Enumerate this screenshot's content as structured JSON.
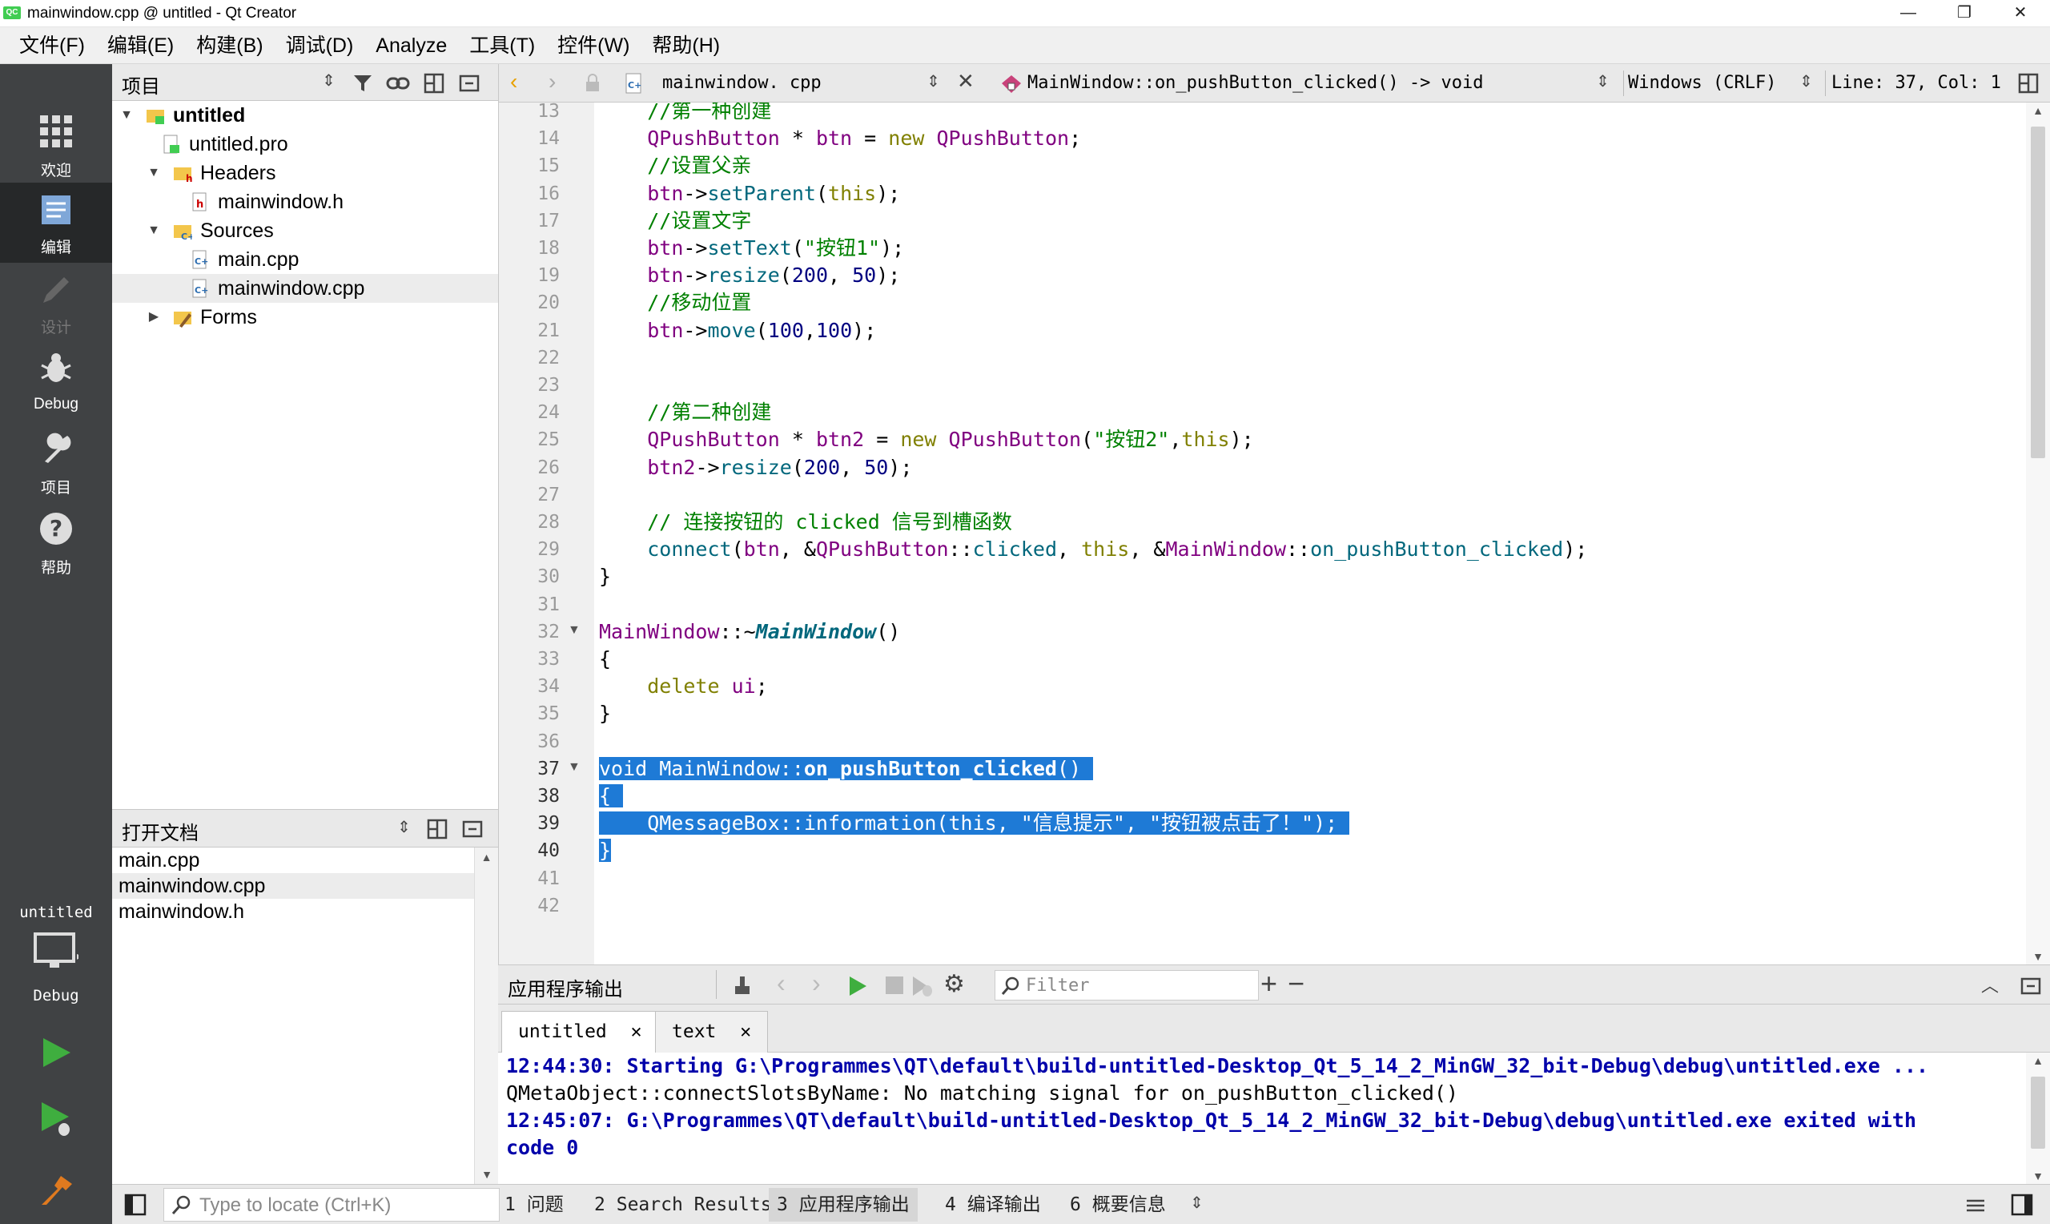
{
  "window": {
    "title": "mainwindow.cpp @ untitled - Qt Creator",
    "app_icon": "QC",
    "controls": {
      "minimize": "—",
      "maximize": "❐",
      "close": "✕"
    }
  },
  "menubar": [
    "文件(F)",
    "编辑(E)",
    "构建(B)",
    "调试(D)",
    "Analyze",
    "工具(T)",
    "控件(W)",
    "帮助(H)"
  ],
  "modes": [
    {
      "id": "welcome",
      "label": "欢迎",
      "icon": "grid-icon"
    },
    {
      "id": "edit",
      "label": "编辑",
      "icon": "edit-icon",
      "active": true
    },
    {
      "id": "design",
      "label": "设计",
      "icon": "pencil-icon",
      "disabled": true
    },
    {
      "id": "debug",
      "label": "Debug",
      "icon": "bug-icon"
    },
    {
      "id": "projects",
      "label": "项目",
      "icon": "wrench-icon"
    },
    {
      "id": "help",
      "label": "帮助",
      "icon": "help-icon"
    }
  ],
  "kit": {
    "project": "untitled",
    "config": "Debug"
  },
  "project_panel": {
    "title": "项目",
    "tree": [
      {
        "label": "untitled",
        "level": 0,
        "expanded": true,
        "bold": true,
        "icon": "project-folder-icon"
      },
      {
        "label": "untitled.pro",
        "level": 1,
        "icon": "pro-file-icon"
      },
      {
        "label": "Headers",
        "level": 1,
        "expanded": true,
        "icon": "headers-folder-icon"
      },
      {
        "label": "mainwindow.h",
        "level": 2,
        "icon": "header-file-icon"
      },
      {
        "label": "Sources",
        "level": 1,
        "expanded": true,
        "icon": "sources-folder-icon"
      },
      {
        "label": "main.cpp",
        "level": 2,
        "icon": "cpp-file-icon"
      },
      {
        "label": "mainwindow.cpp",
        "level": 2,
        "icon": "cpp-file-icon",
        "selected": true
      },
      {
        "label": "Forms",
        "level": 1,
        "expanded": false,
        "icon": "forms-folder-icon"
      }
    ]
  },
  "open_docs": {
    "title": "打开文档",
    "items": [
      "main.cpp",
      "mainwindow.cpp",
      "mainwindow.h"
    ],
    "selected": 1
  },
  "editor_toolbar": {
    "file": "mainwindow. cpp",
    "symbol": "MainWindow::on_pushButton_clicked() -> void",
    "line_ending": "Windows (CRLF)",
    "position": "Line: 37, Col: 1"
  },
  "code_lines": [
    {
      "n": "13",
      "html": "    <span class=\"cm\">//第一种创建</span>"
    },
    {
      "n": "14",
      "html": "    <span class=\"ty\">QPushButton</span> * <span class=\"ty\">btn</span> = <span class=\"kw\">new</span> <span class=\"ty\">QPushButton</span>;"
    },
    {
      "n": "15",
      "html": "    <span class=\"cm\">//设置父亲</span>"
    },
    {
      "n": "16",
      "html": "    <span class=\"ty\">btn</span>-><span class=\"fn\">setParent</span>(<span class=\"kw\">this</span>);"
    },
    {
      "n": "17",
      "html": "    <span class=\"cm\">//设置文字</span>"
    },
    {
      "n": "18",
      "html": "    <span class=\"ty\">btn</span>-><span class=\"fn\">setText</span>(<span class=\"st\">\"按钮1\"</span>);"
    },
    {
      "n": "19",
      "html": "    <span class=\"ty\">btn</span>-><span class=\"fn\">resize</span>(<span class=\"nm\">200</span>, <span class=\"nm\">50</span>);"
    },
    {
      "n": "20",
      "html": "    <span class=\"cm\">//移动位置</span>"
    },
    {
      "n": "21",
      "html": "    <span class=\"ty\">btn</span>-><span class=\"fn\">move</span>(<span class=\"nm\">100</span>,<span class=\"nm\">100</span>);"
    },
    {
      "n": "22",
      "html": ""
    },
    {
      "n": "23",
      "html": ""
    },
    {
      "n": "24",
      "html": "    <span class=\"cm\">//第二种创建</span>"
    },
    {
      "n": "25",
      "html": "    <span class=\"ty\">QPushButton</span> * <span class=\"ty\">btn2</span> = <span class=\"kw\">new</span> <span class=\"ty\">QPushButton</span>(<span class=\"st\">\"按钮2\"</span>,<span class=\"kw\">this</span>);"
    },
    {
      "n": "26",
      "html": "    <span class=\"ty\">btn2</span>-><span class=\"fn\">resize</span>(<span class=\"nm\">200</span>, <span class=\"nm\">50</span>);"
    },
    {
      "n": "27",
      "html": ""
    },
    {
      "n": "28",
      "html": "    <span class=\"cm\">// 连接按钮的 clicked 信号到槽函数</span>"
    },
    {
      "n": "29",
      "html": "    <span class=\"fn\">connect</span>(<span class=\"ty\">btn</span>, &amp;<span class=\"ty\">QPushButton</span>::<span class=\"fn\">clicked</span>, <span class=\"kw\">this</span>, &amp;<span class=\"ty\">MainWindow</span>::<span class=\"fn\">on_pushButton_clicked</span>);"
    },
    {
      "n": "30",
      "html": "}"
    },
    {
      "n": "31",
      "html": ""
    },
    {
      "n": "32",
      "html": "<span class=\"ty\">MainWindow</span>::~<span class=\"fnb\">MainWindow</span>()",
      "fold": true
    },
    {
      "n": "33",
      "html": "{"
    },
    {
      "n": "34",
      "html": "    <span class=\"kw\">delete</span> <span class=\"ty\">ui</span>;"
    },
    {
      "n": "35",
      "html": "}"
    },
    {
      "n": "36",
      "html": ""
    },
    {
      "n": "37",
      "html": "<span class=\"sel\">void MainWindow::<b>on_pushButton_clicked</b>() </span>",
      "fold": true,
      "current": true
    },
    {
      "n": "38",
      "html": "<span class=\"sel\">{ </span>",
      "current": true
    },
    {
      "n": "39",
      "html": "<span class=\"sel\">    QMessageBox::information(this, \"信息提示\", \"按钮被点击了！\"); </span>",
      "current": true
    },
    {
      "n": "40",
      "html": "<span class=\"sel\">}</span>",
      "current": true
    },
    {
      "n": "41",
      "html": ""
    },
    {
      "n": "42",
      "html": ""
    }
  ],
  "output_pane": {
    "title": "应用程序输出",
    "filter_placeholder": "Filter",
    "tabs": [
      {
        "label": "untitled",
        "active": true
      },
      {
        "label": "text",
        "active": false
      }
    ],
    "lines": [
      {
        "text": "12:44:30: Starting G:\\Programmes\\QT\\default\\build-untitled-Desktop_Qt_5_14_2_MinGW_32_bit-Debug\\debug\\untitled.exe ...",
        "bold": true
      },
      {
        "text": "QMetaObject::connectSlotsByName: No matching signal for on_pushButton_clicked()",
        "bold": false
      },
      {
        "text": "12:45:07: G:\\Programmes\\QT\\default\\build-untitled-Desktop_Qt_5_14_2_MinGW_32_bit-Debug\\debug\\untitled.exe exited with",
        "bold": true
      },
      {
        "text": "code 0",
        "bold": true
      }
    ]
  },
  "statusbar": {
    "locator_placeholder": "Type to locate (Ctrl+K)",
    "tabs": [
      {
        "num": "1",
        "label": "问题"
      },
      {
        "num": "2",
        "label": "Search Results"
      },
      {
        "num": "3",
        "label": "应用程序输出",
        "active": true
      },
      {
        "num": "4",
        "label": "编译输出"
      },
      {
        "num": "6",
        "label": "概要信息"
      }
    ]
  },
  "colors": {
    "accent": "#1e7ad6",
    "modebar": "#404244",
    "run_green": "#3fae3f"
  }
}
